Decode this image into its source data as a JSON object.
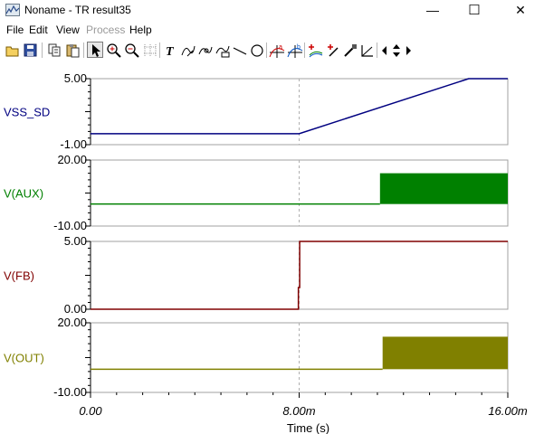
{
  "window": {
    "title": "Noname - TR result35",
    "minimize_glyph": "—",
    "maximize_glyph": "☐",
    "close_glyph": "✕"
  },
  "menu": {
    "items": [
      {
        "label": "File",
        "enabled": true
      },
      {
        "label": "Edit",
        "enabled": true
      },
      {
        "label": "View",
        "enabled": true
      },
      {
        "label": "Process",
        "enabled": false
      },
      {
        "label": "Help",
        "enabled": true
      }
    ]
  },
  "toolbar": {
    "tools": [
      "open-icon",
      "save-icon",
      "copy-icon",
      "paste-icon",
      "pointer-icon",
      "zoom-in-icon",
      "zoom-out-icon",
      "grid-icon",
      "text-icon",
      "annotate-curve-icon",
      "annotate-point-icon",
      "annotate-label-icon",
      "line-icon",
      "circle-icon",
      "cursor-a-icon",
      "cursor-b-icon",
      "add-curve-icon",
      "cursor-pick-icon",
      "probe-icon",
      "angle-icon",
      "scroll-left-icon",
      "scroll-updown-icon",
      "scroll-right-icon"
    ],
    "pressed": "pointer-icon"
  },
  "chart_data": {
    "type": "line",
    "xlabel": "Time (s)",
    "xlim": [
      0,
      0.016
    ],
    "x_ticks": [
      {
        "value": 0,
        "label": "0.00"
      },
      {
        "value": 0.008,
        "label": "8.00m"
      },
      {
        "value": 0.016,
        "label": "16.00m"
      }
    ],
    "grid": true,
    "panels": [
      {
        "name": "VSS_SD",
        "color": "#000080",
        "ylim": [
          -1.0,
          5.0
        ],
        "y_ticks": [
          "5.00",
          "-1.00"
        ],
        "segments": [
          {
            "kind": "line",
            "x": [
              0,
              0.008,
              0.0145,
              0.016
            ],
            "y": [
              0.0,
              0.0,
              5.0,
              5.0
            ]
          }
        ]
      },
      {
        "name": "V(AUX)",
        "color": "#008000",
        "ylim": [
          -10.0,
          20.0
        ],
        "y_ticks": [
          "20.00",
          "-10.00"
        ],
        "segments": [
          {
            "kind": "line",
            "x": [
              0,
              0.0111
            ],
            "y": [
              0.0,
              0.0
            ]
          },
          {
            "kind": "band",
            "x": [
              0.0111,
              0.016
            ],
            "y": [
              0.0,
              14.0
            ]
          }
        ]
      },
      {
        "name": "V(FB)",
        "color": "#800000",
        "ylim": [
          0.0,
          5.0
        ],
        "y_ticks": [
          "5.00",
          "0.00"
        ],
        "segments": [
          {
            "kind": "line",
            "x": [
              0,
              0.00797,
              0.00797,
              0.00802,
              0.00802,
              0.016
            ],
            "y": [
              0.0,
              0.0,
              1.6,
              1.6,
              5.0,
              5.0
            ]
          }
        ]
      },
      {
        "name": "V(OUT)",
        "color": "#808000",
        "ylim": [
          -10.0,
          20.0
        ],
        "y_ticks": [
          "20.00",
          "-10.00"
        ],
        "segments": [
          {
            "kind": "line",
            "x": [
              0,
              0.0112
            ],
            "y": [
              0.0,
              0.0
            ]
          },
          {
            "kind": "band",
            "x": [
              0.0112,
              0.016
            ],
            "y": [
              0.0,
              14.0
            ]
          }
        ]
      }
    ]
  }
}
